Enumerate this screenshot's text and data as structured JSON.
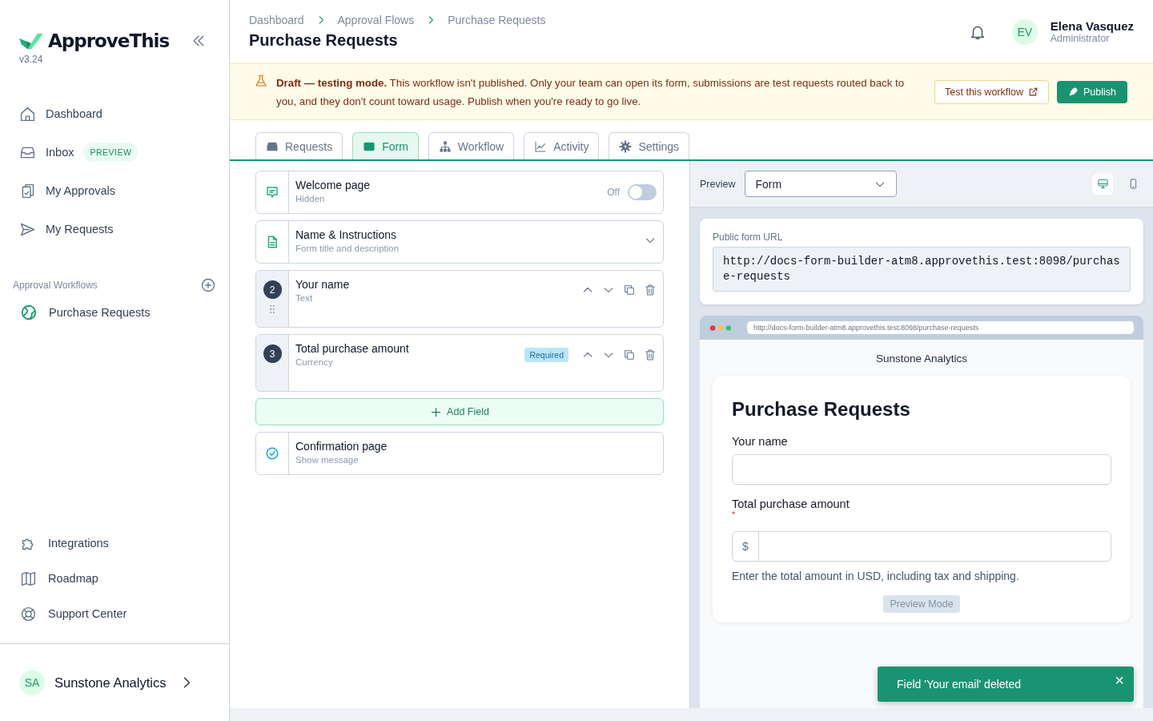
{
  "sidebar": {
    "logo": "ApproveThis",
    "version": "v3.24",
    "nav": [
      {
        "label": "Dashboard"
      },
      {
        "label": "Inbox",
        "badge": "PREVIEW"
      },
      {
        "label": "My Approvals"
      },
      {
        "label": "My Requests"
      }
    ],
    "section_title": "Approval Workflows",
    "workflows": [
      {
        "label": "Purchase Requests"
      }
    ],
    "footer_nav": [
      {
        "label": "Integrations"
      },
      {
        "label": "Roadmap"
      },
      {
        "label": "Support Center"
      }
    ],
    "org": {
      "initials": "SA",
      "name": "Sunstone Analytics"
    }
  },
  "header": {
    "breadcrumbs": [
      "Dashboard",
      "Approval Flows",
      "Purchase Requests"
    ],
    "title": "Purchase Requests",
    "user": {
      "initials": "EV",
      "name": "Elena Vasquez",
      "role": "Administrator"
    }
  },
  "banner": {
    "text": "**Draft — testing mode.** This workflow isn't published. Only your team can open its form, submissions are test requests routed back to you, and they don't count toward usage. Publish when you're ready to go live.",
    "test_button": "Test this workflow",
    "publish_button": "Publish"
  },
  "tabs": [
    {
      "label": "Requests",
      "selected": false
    },
    {
      "label": "Form",
      "selected": true
    },
    {
      "label": "Workflow",
      "selected": false
    },
    {
      "label": "Activity",
      "selected": false
    },
    {
      "label": "Settings",
      "selected": false
    }
  ],
  "form_items": [
    {
      "kind": "welcome",
      "title": "Welcome page",
      "subtitle": "Hidden",
      "toggle_label": "Off",
      "on": false
    },
    {
      "kind": "section",
      "title": "Name & Instructions",
      "subtitle": "Form title and description"
    },
    {
      "kind": "field",
      "number": "2",
      "title": "Your name",
      "subtitle": "Text"
    },
    {
      "kind": "field",
      "number": "3",
      "title": "Total purchase amount",
      "subtitle": "Currency",
      "badge": "Required"
    },
    {
      "kind": "add",
      "title": "Add Field"
    },
    {
      "kind": "confirmation",
      "title": "Confirmation page",
      "subtitle": "Show message"
    }
  ],
  "preview": {
    "label": "Preview",
    "select": "Form",
    "devices": [
      {
        "selected": true
      },
      {
        "selected": false
      }
    ],
    "url_label": "Public form URL",
    "url": "http://docs-form-builder-atm8.approvethis.test:8098/purchase-requests",
    "browser_url": "http://docs-form-builder-atm8.approvethis.test:8098/purchase-requests",
    "org_name": "Sunstone Analytics",
    "form": {
      "title": "Purchase Requests",
      "fields": [
        {
          "kind": "text",
          "label": "Your name"
        },
        {
          "kind": "currency",
          "label": "Total purchase amount",
          "required_mark": "*",
          "prefix": "$",
          "help": "Enter the total amount in USD, including tax and shipping."
        }
      ],
      "submit": "Preview Mode"
    }
  },
  "toast": {
    "message": "Field 'Your email' deleted",
    "close": "×"
  }
}
